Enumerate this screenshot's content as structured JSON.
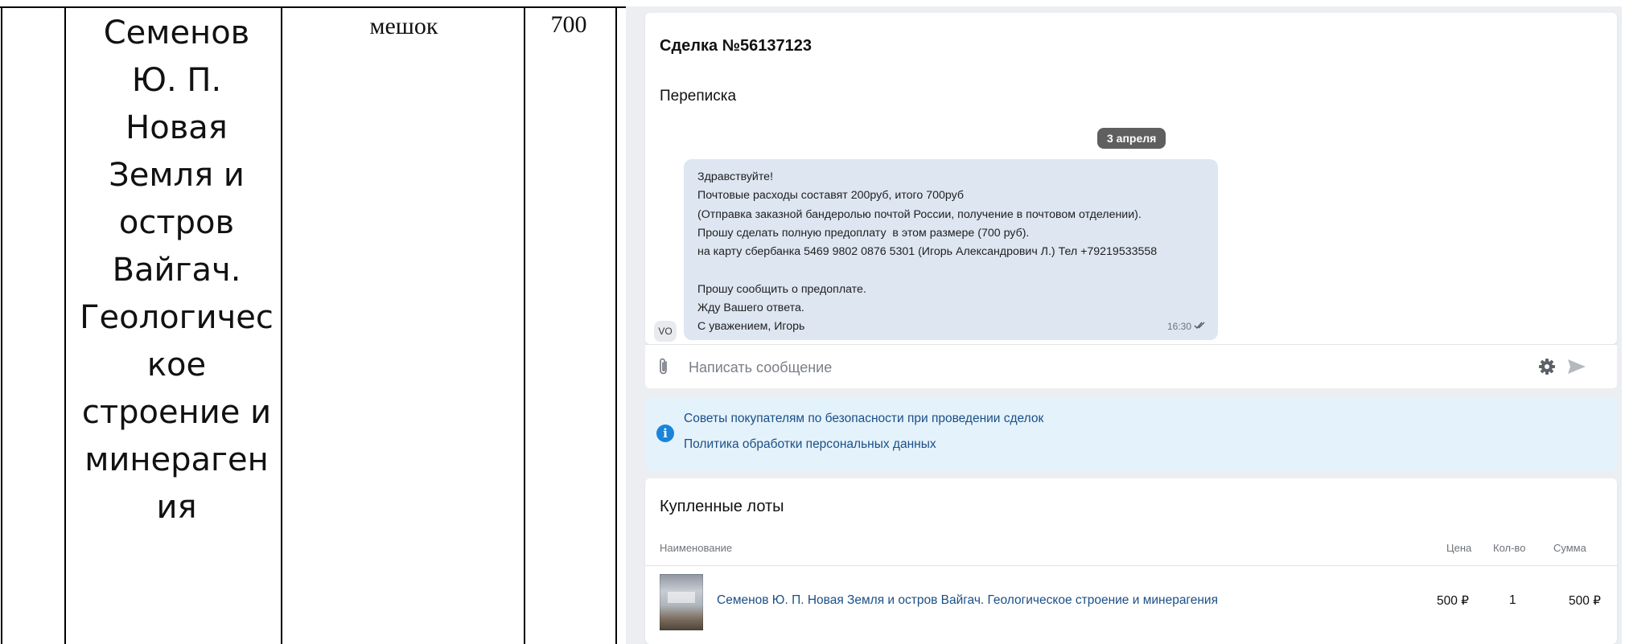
{
  "doc_table": {
    "name_lines": [
      "Семенов",
      "Ю. П.",
      "Новая",
      "Земля и",
      "остров",
      "Вайгач.",
      "Геологичес",
      "кое",
      "строение и",
      "минераген",
      "ия"
    ],
    "unit": "мешок",
    "price": "700"
  },
  "deal": {
    "title": "Сделка №56137123",
    "correspondence_label": "Переписка",
    "date_badge": "3 апреля",
    "avatar": "VO",
    "message_lines": [
      "Здравствуйте!",
      "Почтовые расходы составят 200руб, итого 700руб",
      "(Отправка заказной бандеролью почтой России, получение в почтовом отделении).",
      "Прошу сделать полную предоплату  в этом размере (700 руб).",
      "на карту сбербанка 5469 9802 0876 5301 (Игорь Александрович Л.) Тел +79219533558",
      "",
      "Прошу сообщить о предоплате.",
      "Жду Вашего ответа.",
      "С уважением, Игорь"
    ],
    "message_time": "16:30"
  },
  "compose": {
    "placeholder": "Написать сообщение",
    "icons": [
      "paperclip-icon",
      "gear-icon",
      "send-icon"
    ]
  },
  "info": {
    "icon": "info-icon",
    "link1": "Советы покупателям по безопасности при проведении сделок",
    "link2": "Политика обработки персональных данных"
  },
  "lots": {
    "title": "Купленные лоты",
    "columns": {
      "name": "Наименование",
      "price": "Цена",
      "qty": "Кол-во",
      "sum": "Сумма"
    },
    "items": [
      {
        "name": "Семенов Ю. П. Новая Земля и остров Вайгач. Геологическое строение и минерагения",
        "price": "500 ₽",
        "qty": "1",
        "sum": "500 ₽"
      }
    ]
  },
  "colors": {
    "link": "#1a4f86",
    "bubble": "#dde6f1",
    "info_bg": "#e4f2fb",
    "info_icon": "#1a84d9",
    "date_badge": "#5f5f5f",
    "panel_bg": "#eceef1"
  }
}
